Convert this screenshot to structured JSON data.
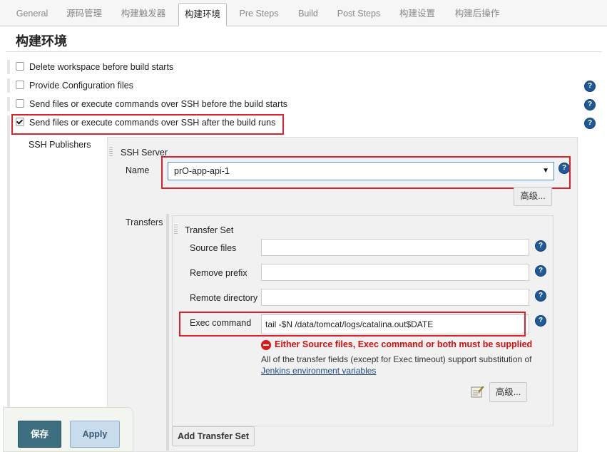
{
  "tabs": [
    {
      "label": "General"
    },
    {
      "label": "源码管理"
    },
    {
      "label": "构建触发器"
    },
    {
      "label": "构建环境"
    },
    {
      "label": "Pre Steps"
    },
    {
      "label": "Build"
    },
    {
      "label": "Post Steps"
    },
    {
      "label": "构建设置"
    },
    {
      "label": "构建后操作"
    }
  ],
  "active_tab": "构建环境",
  "section": {
    "title": "构建环境"
  },
  "options": [
    {
      "label": "Delete workspace before build starts",
      "checked": false
    },
    {
      "label": "Provide Configuration files",
      "checked": false
    },
    {
      "label": "Send files or execute commands over SSH before the build starts",
      "checked": false
    },
    {
      "label": "Send files or execute commands over SSH after the build runs",
      "checked": true
    }
  ],
  "help_icon": "?",
  "ssh": {
    "publishers_label": "SSH Publishers",
    "server_label": "SSH Server",
    "name_label": "Name",
    "name_value": "prO-app-api-1",
    "advanced_label": "高级...",
    "transfers_label": "Transfers",
    "transfer_set_label": "Transfer Set",
    "source_files_label": "Source files",
    "source_files_value": "",
    "remove_prefix_label": "Remove prefix",
    "remove_prefix_value": "",
    "remote_directory_label": "Remote directory",
    "remote_directory_value": "",
    "exec_command_label": "Exec command",
    "exec_command_value": "tail -$N /data/tomcat/logs/catalina.out$DATE",
    "error_text": "Either Source files, Exec command or both must be supplied",
    "note_text": "All of the transfer fields (except for Exec timeout) support substitution of",
    "note_link": "Jenkins environment variables",
    "advanced2_label": "高级...",
    "add_transfer_label": "Add Transfer Set"
  },
  "footer": {
    "save_label": "保存",
    "apply_label": "Apply"
  },
  "colors": {
    "highlight": "#e0202b",
    "save_bg": "#3e6f80",
    "apply_bg": "#c9dceb",
    "help": "#1f5a96",
    "error": "#cc1111"
  }
}
